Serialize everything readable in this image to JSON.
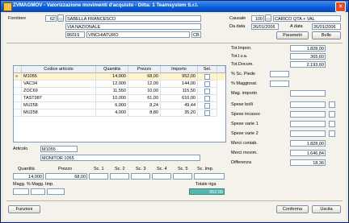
{
  "window": {
    "title": "ZVMAGMOV - Valorizzazione movimenti d'acquisto - Ditta: 1 Teamsystem S.r.l."
  },
  "header": {
    "fornitore_label": "Fornitore",
    "fornitore_code": "62",
    "fornitore_name": "SABELLA FRANCESCO",
    "address": "VIA NAZIONALE",
    "cap": "86019",
    "city": "VINCHIATURO",
    "province": "CB",
    "causale_label": "Causale",
    "causale_code": "100",
    "causale_desc": "CARICO QTA + VAL",
    "da_data_label": "Da data",
    "da_data": "26/01/2006",
    "a_data_label": "A data",
    "a_data": "26/01/2006",
    "parametri_label": "Parametri",
    "bolle_label": "Bolle"
  },
  "grid": {
    "headers": [
      "Codice articolo",
      "Quantità",
      "Prezzo",
      "Importo",
      "Sel."
    ],
    "current_marker": "»",
    "rows": [
      {
        "code": "M1055",
        "qty": "14,000",
        "price": "68,00",
        "amount": "952,00"
      },
      {
        "code": "VAC34",
        "qty": "12,000",
        "price": "12,00",
        "amount": "144,00"
      },
      {
        "code": "ZOC69",
        "qty": "11,550",
        "price": "10,00",
        "amount": "115,50"
      },
      {
        "code": "TAST987",
        "qty": "10,000",
        "price": "61,00",
        "amount": "610,00"
      },
      {
        "code": "MU258",
        "qty": "6,000",
        "price": "8,24",
        "amount": "49,44"
      },
      {
        "code": "MU258",
        "qty": "4,000",
        "price": "8,80",
        "amount": "35,20"
      }
    ]
  },
  "article": {
    "label": "Articolo",
    "code": "M1055",
    "description": "MONITOR 1055"
  },
  "detail": {
    "headers": [
      "Quantità",
      "Prezzo",
      "Sc. 1",
      "Sc. 2",
      "Sc. 3",
      "Sc. 4",
      "Sc. 5",
      "Sc. Imp."
    ],
    "quantity": "14,000",
    "price": "68,00",
    "magg_label": "Magg. % Magg. Imp.",
    "total_row_label": "Totale riga",
    "total_row": "952,00"
  },
  "totals": {
    "tot_impon_label": "Tot.Impon.",
    "tot_impon": "1.828,00",
    "tot_iva_label": "Tot.I.v.a.",
    "tot_iva": "365,60",
    "tot_docum_label": "Tot.Docum.",
    "tot_docum": "2.193,60",
    "sc_piede_label": "% Sc. Piede",
    "maggiorat_label": "% Maggiorat.",
    "mag_importo_label": "Mag. importo",
    "spese_bolli_label": "Spese bolli",
    "spese_incasso_label": "Spese incasso",
    "spese_varie1_label": "Spese varie 1",
    "spese_varie2_label": "Spese varie 2",
    "merci_contab_label": "Merci contab.",
    "merci_contab": "1.828,00",
    "merci_movim_label": "Merci movim.",
    "merci_movim": "1.646,84",
    "differenza_label": "Differenza",
    "differenza": "18,36"
  },
  "footer": {
    "funzioni_label": "Funzioni",
    "conferma_label": "Conferma",
    "uscita_label": "Uscita"
  }
}
